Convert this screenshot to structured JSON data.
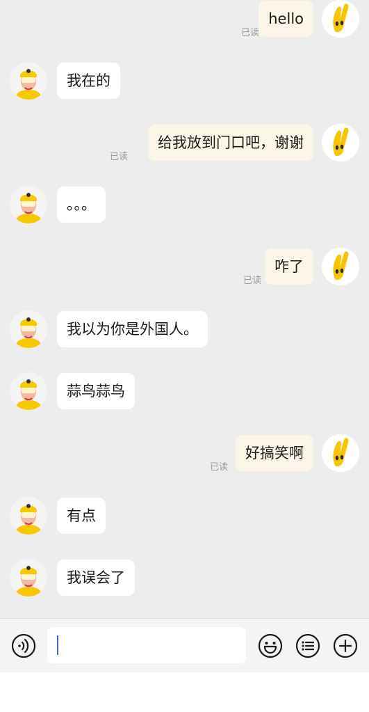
{
  "messages": [
    {
      "side": "out",
      "text": "hello",
      "read": "已读"
    },
    {
      "side": "in",
      "text": "我在的"
    },
    {
      "side": "out",
      "text": "给我放到门口吧，谢谢",
      "read": "已读"
    },
    {
      "side": "in",
      "text": "。。。"
    },
    {
      "side": "out",
      "text": "咋了",
      "read": "已读"
    },
    {
      "side": "in",
      "text": "我以为你是外国人。"
    },
    {
      "side": "in",
      "text": "蒜鸟蒜鸟"
    },
    {
      "side": "out",
      "text": "好搞笑啊",
      "read": "已读"
    },
    {
      "side": "in",
      "text": "有点"
    },
    {
      "side": "in",
      "text": "我误会了"
    }
  ],
  "input": {
    "value": "",
    "icons": [
      "voice-icon",
      "emoji-icon",
      "more-menu-icon",
      "add-icon"
    ]
  },
  "colors": {
    "background": "#ededed",
    "incoming_bubble": "#ffffff",
    "outgoing_bubble": "#fbf6e7",
    "caret": "#3b6fd8"
  }
}
